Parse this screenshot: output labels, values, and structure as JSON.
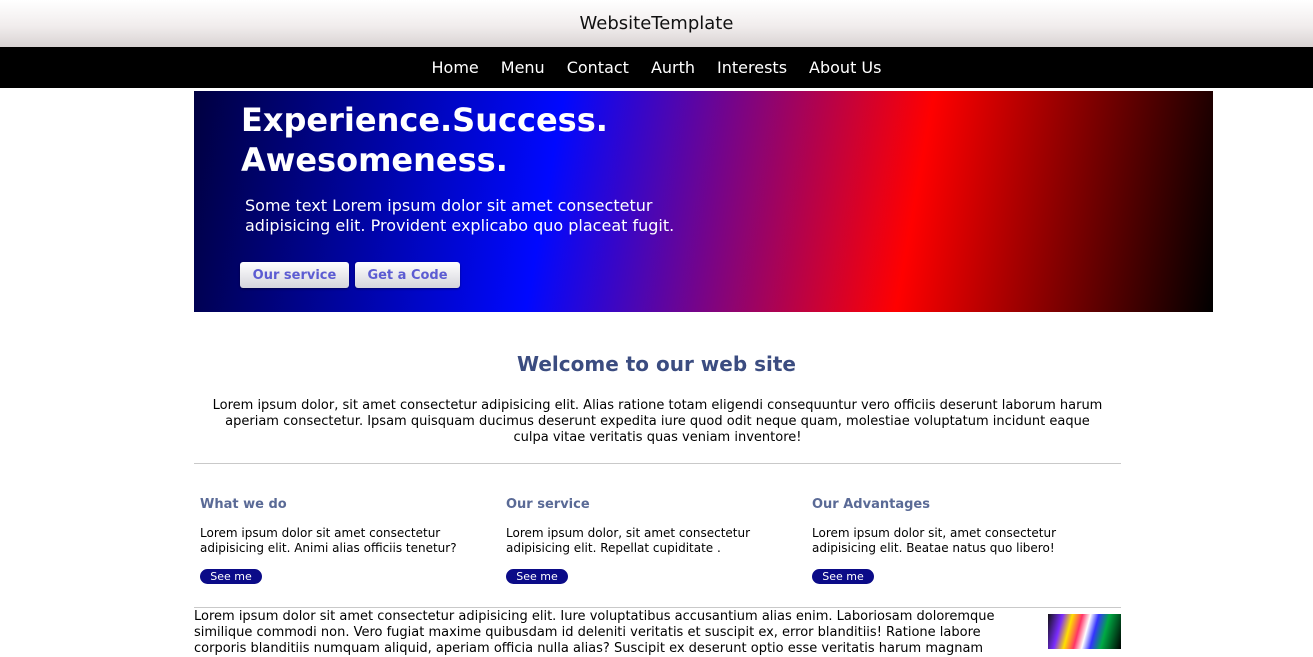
{
  "site": {
    "title": "WebsiteTemplate"
  },
  "nav": [
    "Home",
    "Menu",
    "Contact",
    "Aurth",
    "Interests",
    "About Us"
  ],
  "hero": {
    "title": "Experience.Success. Awesomeness.",
    "text": "Some text Lorem ipsum dolor sit amet consectetur adipisicing elit. Provident explicabo quo placeat fugit.",
    "button1": "Our service",
    "button2": "Get a Code"
  },
  "welcome": {
    "title": "Welcome to our web site",
    "text": "Lorem ipsum dolor, sit amet consectetur adipisicing elit. Alias ratione totam eligendi consequuntur vero officiis deserunt laborum harum aperiam consectetur. Ipsam quisquam ducimus deserunt expedita iure quod odit neque quam, molestiae voluptatum incidunt eaque culpa vitae veritatis quas veniam inventore!"
  },
  "columns": [
    {
      "heading": "What we do",
      "text": "Lorem ipsum dolor sit amet consectetur adipisicing elit. Animi alias officiis tenetur?",
      "button": "See me"
    },
    {
      "heading": "Our service",
      "text": "Lorem ipsum dolor, sit amet consectetur adipisicing elit. Repellat cupiditate .",
      "button": "See me"
    },
    {
      "heading": "Our Advantages",
      "text": "Lorem ipsum dolor sit, amet consectetur adipisicing elit. Beatae natus quo libero!",
      "button": "See me"
    }
  ],
  "bottom": {
    "text": "Lorem ipsum dolor sit amet consectetur adipisicing elit. Iure voluptatibus accusantium alias enim. Laboriosam doloremque similique commodi non. Vero fugiat maxime quibusdam id deleniti veritatis et suscipit ex, error blanditiis! Ratione labore corporis blanditiis numquam aliquid, aperiam officia nulla alias? Suscipit ex deserunt optio esse veritatis harum magnam"
  }
}
